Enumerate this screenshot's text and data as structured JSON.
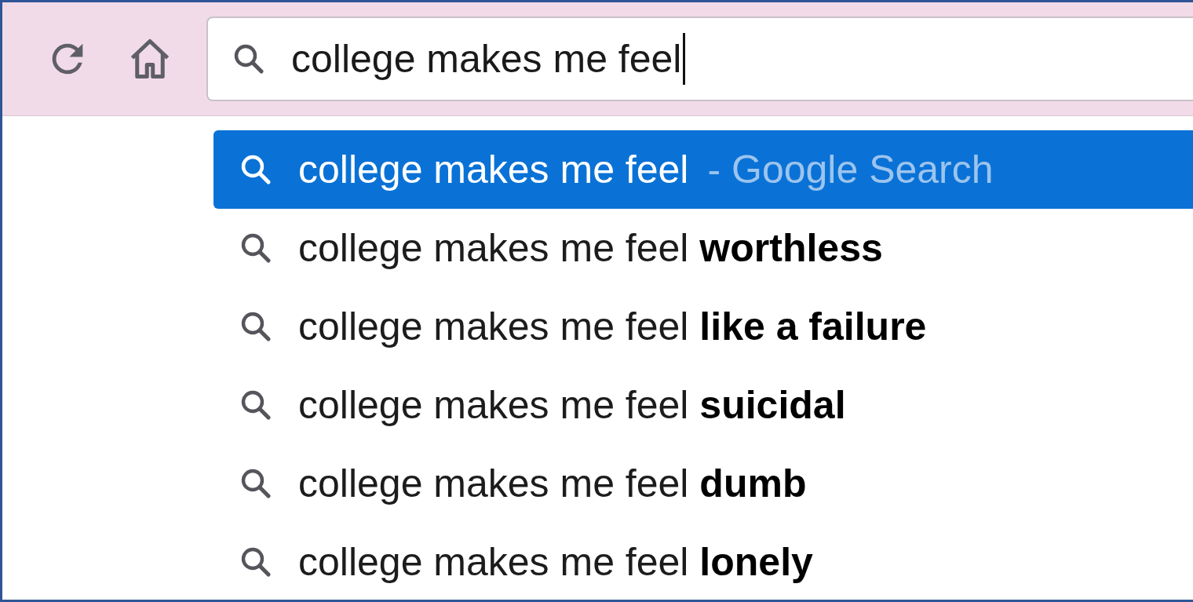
{
  "toolbar": {
    "buttons": [
      {
        "kind": "reload"
      },
      {
        "kind": "home"
      }
    ]
  },
  "address_bar": {
    "value": "college makes me feel",
    "focused": true
  },
  "suggestions": [
    {
      "text": "college makes me feel",
      "suffix": "- Google Search",
      "selected": true
    },
    {
      "text": "college makes me feel **worthless**",
      "selected": false
    },
    {
      "text": "college makes me feel **like a failure**",
      "selected": false
    },
    {
      "text": "college makes me feel **suicidal**",
      "selected": false
    },
    {
      "text": "college makes me feel **dumb**",
      "selected": false
    },
    {
      "text": "college makes me feel **lonely**",
      "selected": false
    }
  ]
}
